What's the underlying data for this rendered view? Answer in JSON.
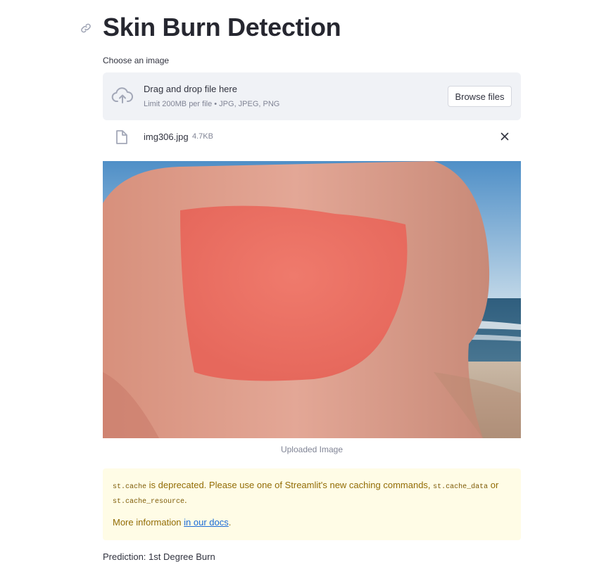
{
  "page": {
    "title": "Skin Burn Detection"
  },
  "uploader": {
    "label": "Choose an image",
    "drag_text": "Drag and drop file here",
    "limit_text": "Limit 200MB per file • JPG, JPEG, PNG",
    "browse_label": "Browse files",
    "icons": {
      "upload": "cloud-upload-icon",
      "file": "file-icon",
      "remove": "close-icon",
      "anchor": "link-icon"
    }
  },
  "file": {
    "name": "img306.jpg",
    "size": "4.7KB"
  },
  "image": {
    "caption": "Uploaded Image",
    "description": "sunburned back on a beach"
  },
  "alert": {
    "code1": "st.cache",
    "text1": " is deprecated. Please use one of Streamlit's new caching commands, ",
    "code2": "st.cache_data",
    "text2": " or",
    "code3": "st.cache_resource",
    "text3": ".",
    "more_prefix": "More information ",
    "link_text": "in our docs",
    "more_suffix": ".",
    "colors": {
      "background": "#fffce6",
      "text": "#926c05",
      "link": "#1c6bd6"
    }
  },
  "prediction": {
    "text": "Prediction: 1st Degree Burn"
  }
}
